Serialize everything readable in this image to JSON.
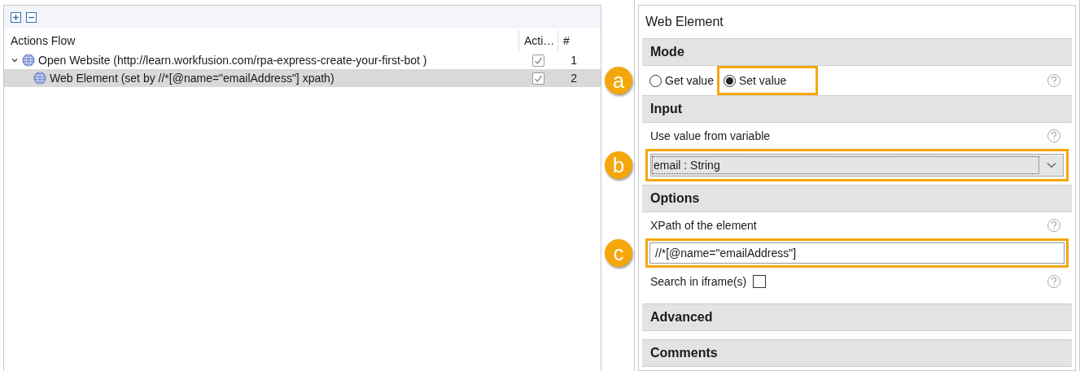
{
  "tree": {
    "columns": [
      "Actions Flow",
      "Acti…",
      "#"
    ],
    "rows": [
      {
        "label": "Open Website (http://learn.workfusion.com/rpa-express-create-your-first-bot )",
        "expanded": true,
        "checked": true,
        "number": "1",
        "selected": false,
        "children": [
          {
            "label": "Web Element (set by //*[@name=\"emailAddress\"] xpath)",
            "checked": true,
            "number": "2",
            "selected": true
          }
        ]
      }
    ]
  },
  "panel": {
    "title": "Web Element",
    "mode": {
      "header": "Mode",
      "callout": "a",
      "options": [
        {
          "label": "Get value",
          "selected": false,
          "highlighted": false
        },
        {
          "label": "Set value",
          "selected": true,
          "highlighted": true
        }
      ]
    },
    "input": {
      "header": "Input",
      "label": "Use value from variable",
      "value": "email : String",
      "callout": "b",
      "highlighted": true
    },
    "options": {
      "header": "Options",
      "label": "XPath of the element",
      "value": "//*[@name=\"emailAddress\"]",
      "callout": "c",
      "highlighted": true,
      "iframe_label": "Search in iframe(s)",
      "iframe_checked": false
    },
    "sections": [
      "Advanced",
      "Comments"
    ]
  }
}
